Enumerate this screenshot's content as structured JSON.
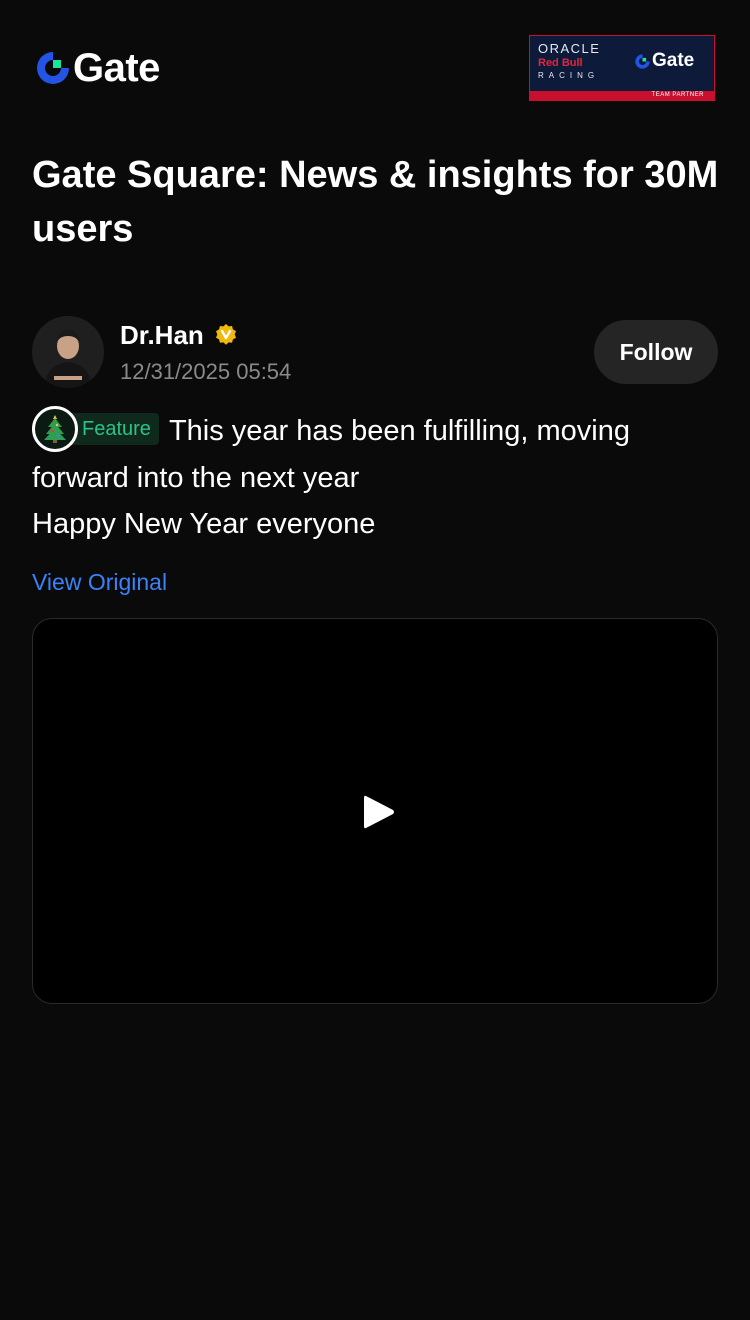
{
  "header": {
    "logo_text": "Gate",
    "partner": {
      "line1": "ORACLE",
      "line2": "Red Bull",
      "line3": "RACING",
      "brand": "Gate",
      "bar": "TEAM PARTNER"
    }
  },
  "page_title": "Gate Square: News & insights for 30M users",
  "author": {
    "name": "Dr.Han",
    "date": "12/31/2025 05:54",
    "verified": true
  },
  "follow_label": "Follow",
  "post": {
    "badge_icon": "christmas-tree-icon",
    "badge_label": "Feature",
    "line1": "This year has been fulfilling, moving forward into the next year",
    "line2": "Happy New Year everyone"
  },
  "view_original_label": "View Original",
  "colors": {
    "background": "#0a0a0a",
    "brand_blue": "#2354e6",
    "brand_green": "#17e6a1",
    "link": "#3b82f6",
    "feature_green": "#2bc287",
    "verified_gold": "#f0b90b"
  }
}
